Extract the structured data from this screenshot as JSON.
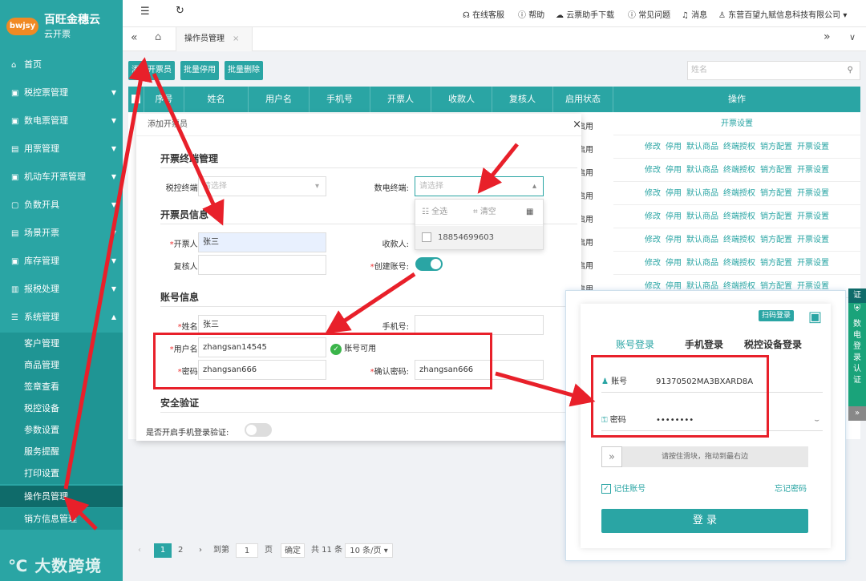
{
  "sidebar": {
    "logo_badge": "bwjsy",
    "logo_title": "百旺金穗云",
    "logo_sub": "云开票",
    "items": [
      {
        "label": "首页",
        "icon": "home-icon"
      },
      {
        "label": "税控票管理",
        "icon": "invoice-icon"
      },
      {
        "label": "数电票管理",
        "icon": "digital-invoice-icon"
      },
      {
        "label": "用票管理",
        "icon": "ticket-icon"
      },
      {
        "label": "机动车开票管理",
        "icon": "car-icon"
      },
      {
        "label": "负数开具",
        "icon": "minus-icon"
      },
      {
        "label": "场景开票",
        "icon": "scene-icon"
      },
      {
        "label": "库存管理",
        "icon": "inventory-icon"
      },
      {
        "label": "报税处理",
        "icon": "tax-icon"
      },
      {
        "label": "系统管理",
        "icon": "settings-icon"
      }
    ],
    "sub_items": [
      "客户管理",
      "商品管理",
      "签章查看",
      "税控设备",
      "参数设置",
      "服务提醒",
      "打印设置",
      "操作员管理",
      "销方信息管理"
    ],
    "watermark": "大数跨境"
  },
  "topbar": {
    "links": [
      "在线客服",
      "帮助",
      "云票助手下载",
      "常见问题",
      "消息",
      "东营百望九赋信息科技有限公司"
    ]
  },
  "tabbar": {
    "active_tab": "操作员管理"
  },
  "toolbar": {
    "add_label": "添加开票员",
    "disable_label": "批量停用",
    "delete_label": "批量删除",
    "search_placeholder": "姓名"
  },
  "table": {
    "headers": [
      "序号",
      "姓名",
      "用户名",
      "手机号",
      "开票人",
      "收款人",
      "复核人",
      "启用状态",
      "操作"
    ],
    "status_text": "启用",
    "first_row_action": "开票设置",
    "actions": [
      "修改",
      "停用",
      "默认商品",
      "终端授权",
      "销方配置",
      "开票设置"
    ]
  },
  "pager": {
    "current": "1",
    "next_page": "2",
    "goto_label": "到第",
    "goto_value": "1",
    "page_label": "页",
    "confirm": "确定",
    "total": "共 11 条",
    "per_page": "10 条/页"
  },
  "modal": {
    "title": "添加开票员",
    "sec_terminal": "开票终端管理",
    "lbl_tax_terminal": "税控终端:",
    "tax_terminal_ph": "请选择",
    "lbl_digital_terminal": "数电终端:",
    "digital_terminal_ph": "请选择",
    "dropdown_select_all": "全选",
    "dropdown_clear": "清空",
    "dropdown_option": "18854699603",
    "sec_operator": "开票员信息",
    "lbl_issuer": "开票人:",
    "issuer_value": "张三",
    "lbl_payee": "收款人:",
    "lbl_reviewer": "复核人:",
    "lbl_create_account": "创建账号:",
    "sec_account": "账号信息",
    "lbl_name": "姓名:",
    "name_value": "张三",
    "lbl_phone": "手机号:",
    "lbl_username": "用户名:",
    "username_value": "zhangsan14545",
    "username_ok": "账号可用",
    "lbl_password": "密码:",
    "password_value": "zhangsan666",
    "lbl_confirm_password": "确认密码:",
    "confirm_password_value": "zhangsan666",
    "sec_security": "安全验证",
    "lbl_phone_verify": "是否开启手机登录验证:"
  },
  "login": {
    "qr_label": "扫码登录",
    "tab_account": "账号登录",
    "tab_phone": "手机登录",
    "tab_device": "税控设备登录",
    "lbl_account": "账号",
    "account_value": "91370502MA3BXARD8A",
    "lbl_password": "密码",
    "password_value": "••••••••",
    "slider_text": "请按住滑块，拖动到最右边",
    "remember": "记住账号",
    "forgot": "忘记密码",
    "submit": "登 录"
  },
  "side_tab": {
    "top_label": "证",
    "label_chars": [
      "数",
      "电",
      "登",
      "录",
      "认",
      "证"
    ]
  },
  "colors": {
    "accent": "#2aa5a4",
    "annotation": "#e8202a"
  }
}
